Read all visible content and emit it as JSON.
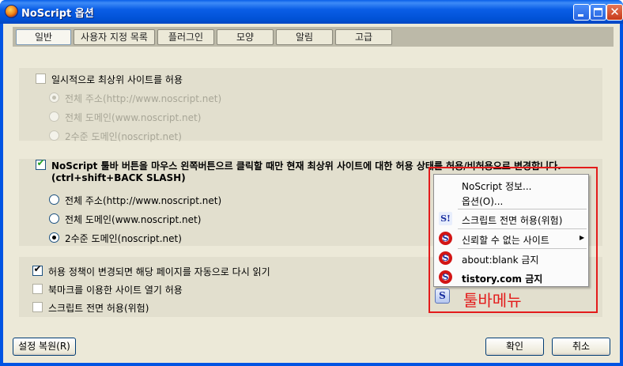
{
  "window": {
    "title": "NoScript 옵션"
  },
  "tabs": [
    {
      "label": "일반",
      "active": true
    },
    {
      "label": "사용자 지정 목록",
      "active": false
    },
    {
      "label": "플러그인",
      "active": false
    },
    {
      "label": "모양",
      "active": false
    },
    {
      "label": "알림",
      "active": false
    },
    {
      "label": "고급",
      "active": false
    }
  ],
  "general": {
    "temp_allow_top": {
      "label": "일시적으로 최상위 사이트를 허용",
      "checked": false
    },
    "temp_allow_options": [
      {
        "label": "전체 주소(http://www.noscript.net)",
        "selected": true,
        "enabled": false
      },
      {
        "label": "전체 도메인(www.noscript.net)",
        "selected": false,
        "enabled": false
      },
      {
        "label": "2수준 도메인(noscript.net)",
        "selected": false,
        "enabled": false
      }
    ],
    "toolbar_click": {
      "label_line1": "NoScript 툴바 버튼을 마우스 왼쪽버튼으르 클릭할 때만 현재 최상위 사이트에 대한 허용 상태를 허용/비허용으로 변경합니다.",
      "label_line2": "(ctrl+shift+BACK SLASH)",
      "checked": true
    },
    "toolbar_click_options": [
      {
        "label": "전체 주소(http://www.noscript.net)",
        "selected": false
      },
      {
        "label": "전체 도메인(www.noscript.net)",
        "selected": false
      },
      {
        "label": "2수준 도메인(noscript.net)",
        "selected": true
      }
    ],
    "auto_reload": {
      "label": "허용 정책이 변경되면 해당 페이지를 자동으로 다시 읽기",
      "checked": true
    },
    "bookmarks": {
      "label": "북마크를 이용한 사이트 열기 허용",
      "checked": false
    },
    "global_allow": {
      "label": "스크립트 전면 허용(위험)",
      "checked": false
    }
  },
  "footer": {
    "reset_label": "설정 복원(R)",
    "ok_label": "확인",
    "cancel_label": "취소"
  },
  "toolbar_menu": {
    "items": [
      {
        "label": "NoScript 정보...",
        "icon": "none"
      },
      {
        "label": "옵션(O)...",
        "icon": "none"
      },
      {
        "label": "스크립트 전면 허용(위험)",
        "icon": "noscript-allow-icon"
      },
      {
        "label": "신뢰할 수 없는 사이트",
        "icon": "noscript-forbid-icon",
        "submenu": true
      },
      {
        "label": "about:blank 금지",
        "icon": "noscript-forbid-icon"
      },
      {
        "label": "tistory.com 금지",
        "icon": "noscript-forbid-icon",
        "bold": true
      }
    ],
    "caption": "툴바메뉴",
    "highlight_color": "#e31b1b"
  },
  "colors": {
    "titlebar": "#0054e3",
    "dialog_bg": "#ece9d8",
    "check_green": "#21a121"
  }
}
